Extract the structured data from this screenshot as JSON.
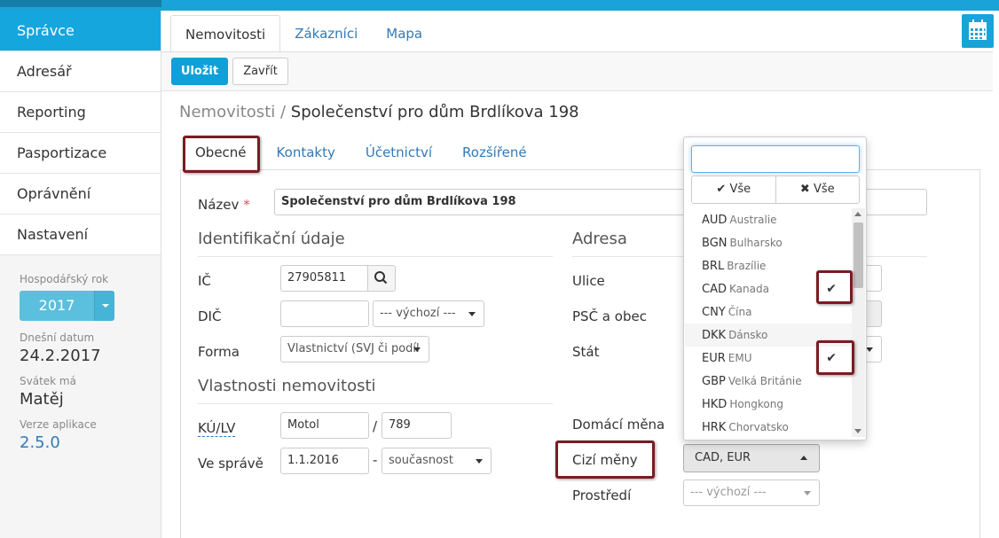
{
  "sidebar": {
    "items": [
      {
        "label": "Správce"
      },
      {
        "label": "Adresář"
      },
      {
        "label": "Reporting"
      },
      {
        "label": "Pasportizace"
      },
      {
        "label": "Oprávnění"
      },
      {
        "label": "Nastavení"
      }
    ],
    "fiscal_year_label": "Hospodářský rok",
    "fiscal_year_value": "2017",
    "today_label": "Dnešní datum",
    "today_value": "24.2.2017",
    "nameday_label": "Svátek má",
    "nameday_value": "Matěj",
    "version_label": "Verze aplikace",
    "version_value": "2.5.0"
  },
  "header": {
    "tabs": [
      {
        "label": "Nemovitosti"
      },
      {
        "label": "Zákazníci"
      },
      {
        "label": "Mapa"
      }
    ],
    "calendar_icon": "calendar-icon"
  },
  "toolbar": {
    "save_label": "Uložit",
    "close_label": "Zavřít"
  },
  "breadcrumb": {
    "parent": "Nemovitosti",
    "separator": "/",
    "current": "Společenství pro dům Brdlíkova 198"
  },
  "subtabs": [
    {
      "label": "Obecné"
    },
    {
      "label": "Kontakty"
    },
    {
      "label": "Účetnictví"
    },
    {
      "label": "Rozšířené"
    }
  ],
  "form": {
    "name_label": "Název",
    "required_mark": "*",
    "name_value": "Společenství pro dům Brdlíkova 198",
    "ident_section": "Identifikační údaje",
    "ic_label": "IČ",
    "ic_value": "27905811",
    "dic_label": "DIČ",
    "dic_value": "",
    "dic_select": "--- výchozí ---",
    "forma_label": "Forma",
    "forma_value": "Vlastnictví (SVJ či podíl",
    "props_section": "Vlastnosti nemovitosti",
    "kulv_label": "KÚ/LV",
    "ku_value": "Motol",
    "lv_separator": "/",
    "lv_value": "789",
    "vesprave_label": "Ve správě",
    "vesprave_from": "1.1.2016",
    "vesprave_dash": "-",
    "vesprave_to": "současnost",
    "address_section": "Adresa",
    "ulice_label": "Ulice",
    "psc_label": "PSČ a obec",
    "stat_label": "Stát",
    "home_currency_label": "Domácí měna",
    "foreign_currency_label": "Cizí měny",
    "foreign_currency_value": "CAD, EUR",
    "env_label": "Prostředí",
    "env_value": "--- výchozí ---"
  },
  "dropdown": {
    "search_value": "",
    "select_all_label": "Vše",
    "deselect_all_label": "Vše",
    "items": [
      {
        "code": "AUD",
        "name": "Australie",
        "checked": false
      },
      {
        "code": "BGN",
        "name": "Bulharsko",
        "checked": false
      },
      {
        "code": "BRL",
        "name": "Brazílie",
        "checked": false
      },
      {
        "code": "CAD",
        "name": "Kanada",
        "checked": true
      },
      {
        "code": "CNY",
        "name": "Čína",
        "checked": false
      },
      {
        "code": "DKK",
        "name": "Dánsko",
        "checked": false
      },
      {
        "code": "EUR",
        "name": "EMU",
        "checked": true
      },
      {
        "code": "GBP",
        "name": "Velká Británie",
        "checked": false
      },
      {
        "code": "HKD",
        "name": "Hongkong",
        "checked": false
      },
      {
        "code": "HRK",
        "name": "Chorvatsko",
        "checked": false
      }
    ],
    "check_glyph": "✔"
  },
  "colors": {
    "primary": "#15a6dd",
    "highlight_box": "#7a1c22",
    "link": "#337ab7"
  }
}
